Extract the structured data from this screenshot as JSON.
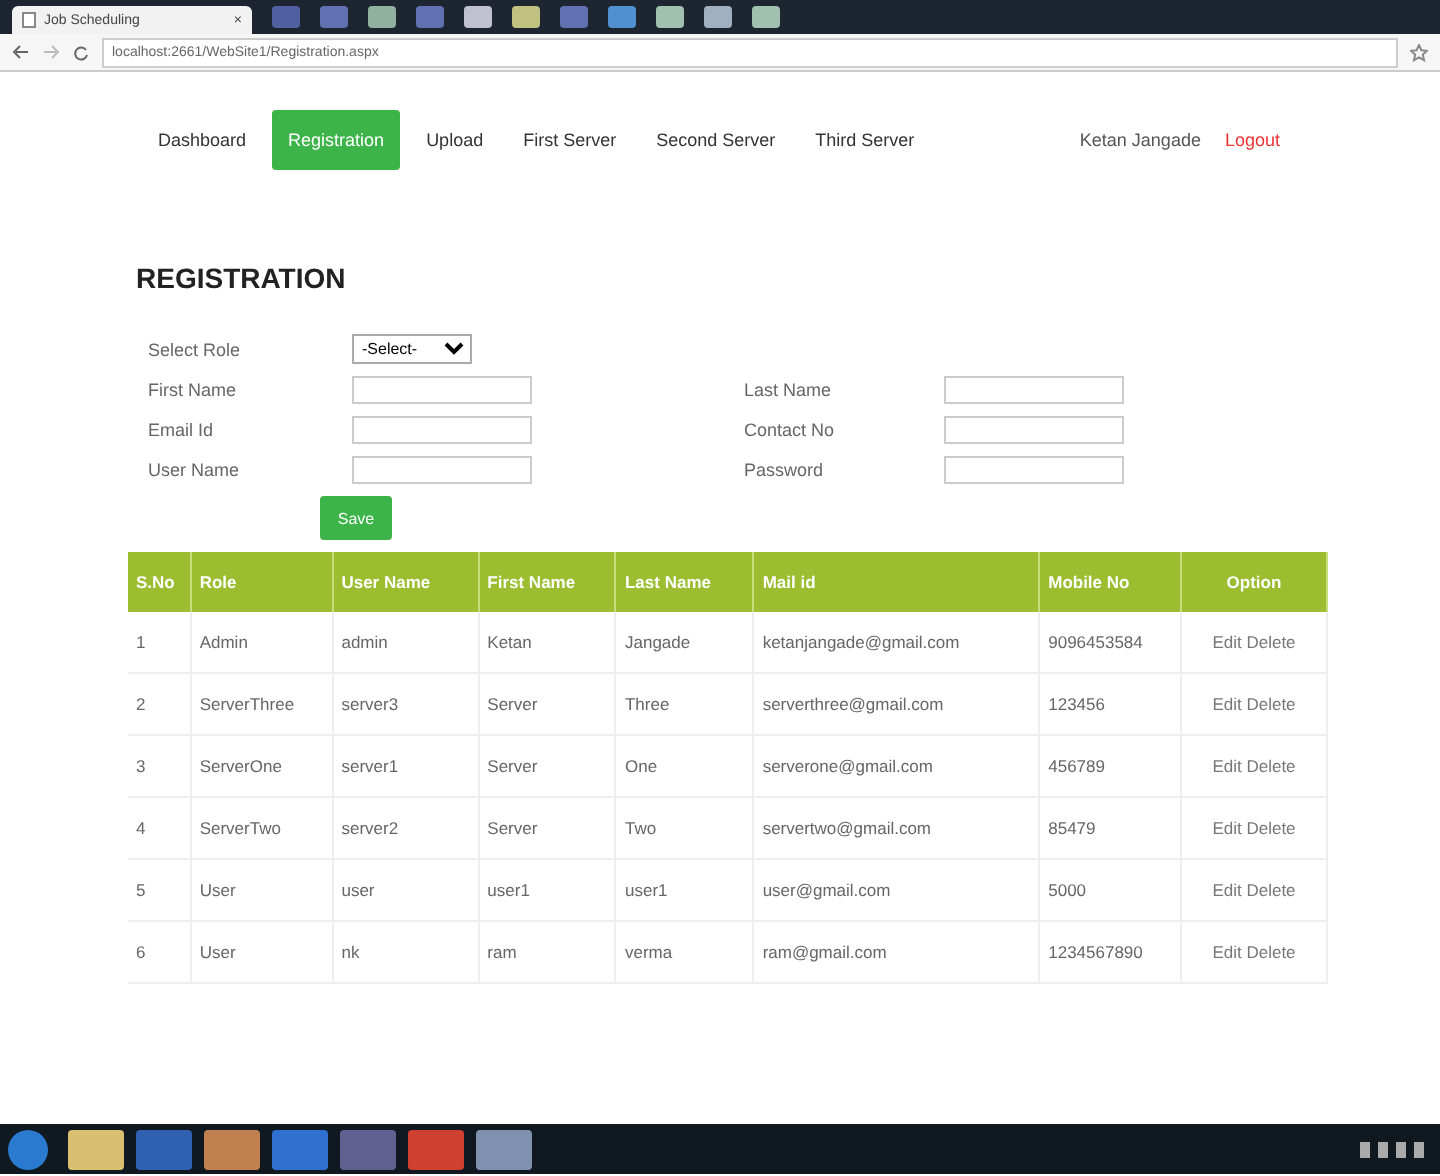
{
  "browser": {
    "tab_title": "Job Scheduling",
    "tab_close": "×",
    "address": "localhost:2661/WebSite1/Registration.aspx"
  },
  "nav": {
    "items": [
      {
        "label": "Dashboard",
        "selected": false
      },
      {
        "label": "Registration",
        "selected": true
      },
      {
        "label": "Upload",
        "selected": false
      },
      {
        "label": "First Server",
        "selected": false
      },
      {
        "label": "Second Server",
        "selected": false
      },
      {
        "label": "Third Server",
        "selected": false
      }
    ],
    "user": "Ketan Jangade",
    "logout": "Logout"
  },
  "form": {
    "title": "REGISTRATION",
    "role_label": "Select Role",
    "role_value": "-Select-",
    "fields": [
      {
        "label": "First Name"
      },
      {
        "label": "Last Name"
      },
      {
        "label": "Email Id"
      },
      {
        "label": "Contact No"
      },
      {
        "label": "User Name"
      },
      {
        "label": "Password"
      }
    ],
    "save": "Save"
  },
  "table": {
    "columns": [
      "S.No",
      "Role",
      "User Name",
      "First Name",
      "Last Name",
      "Mail id",
      "Mobile No",
      "Option"
    ],
    "rows": [
      {
        "cells": [
          "1",
          "Admin",
          "admin",
          "Ketan",
          "Jangade",
          "ketanjangade@gmail.com",
          "9096453584"
        ],
        "edit": "Edit",
        "delete": "Delete"
      },
      {
        "cells": [
          "2",
          "ServerThree",
          "server3",
          "Server",
          "Three",
          "serverthree@gmail.com",
          "123456"
        ],
        "edit": "Edit",
        "delete": "Delete"
      },
      {
        "cells": [
          "3",
          "ServerOne",
          "server1",
          "Server",
          "One",
          "serverone@gmail.com",
          "456789"
        ],
        "edit": "Edit",
        "delete": "Delete"
      },
      {
        "cells": [
          "4",
          "ServerTwo",
          "server2",
          "Server",
          "Two",
          "servertwo@gmail.com",
          "85479"
        ],
        "edit": "Edit",
        "delete": "Delete"
      },
      {
        "cells": [
          "5",
          "User",
          "user",
          "user1",
          "user1",
          "user@gmail.com",
          "5000"
        ],
        "edit": "Edit",
        "delete": "Delete"
      },
      {
        "cells": [
          "6",
          "User",
          "nk",
          "ram",
          "verma",
          "ram@gmail.com",
          "1234567890"
        ],
        "edit": "Edit",
        "delete": "Delete"
      }
    ]
  }
}
